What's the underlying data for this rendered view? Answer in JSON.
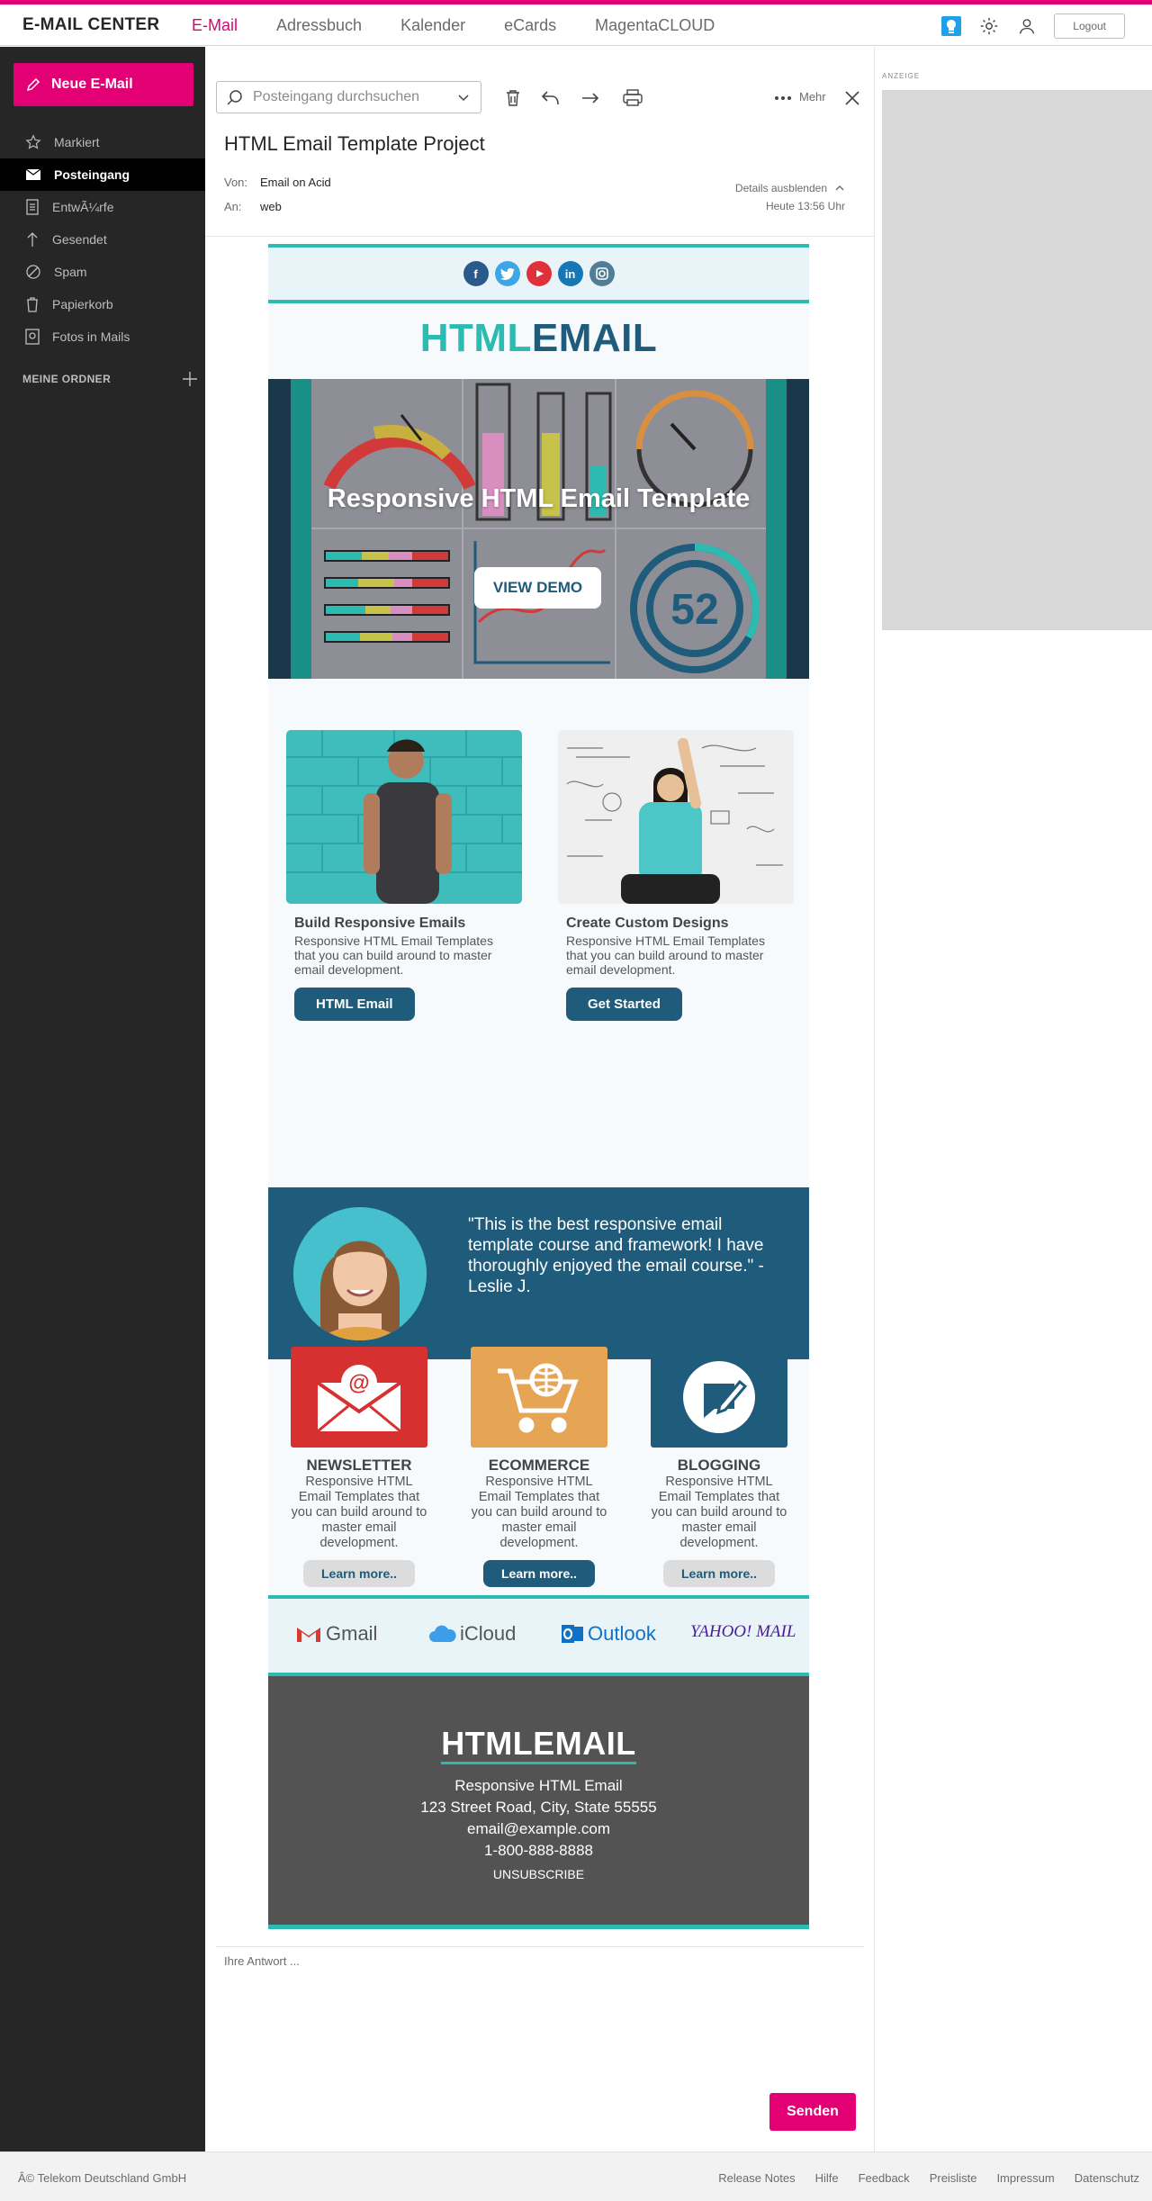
{
  "app": {
    "brand": "E-MAIL CENTER",
    "nav": [
      "E-Mail",
      "Adressbuch",
      "Kalender",
      "eCards",
      "MagentaCLOUD"
    ],
    "logout": "Logout"
  },
  "sidebar": {
    "new_mail": "Neue E-Mail",
    "items": [
      {
        "label": "Markiert",
        "icon": "star-icon"
      },
      {
        "label": "Posteingang",
        "icon": "envelope-icon",
        "active": true
      },
      {
        "label": "EntwÃ¼rfe",
        "icon": "draft-icon"
      },
      {
        "label": "Gesendet",
        "icon": "sent-icon"
      },
      {
        "label": "Spam",
        "icon": "spam-icon"
      },
      {
        "label": "Papierkorb",
        "icon": "trash-icon"
      },
      {
        "label": "Fotos in Mails",
        "icon": "photo-icon"
      }
    ],
    "my_folders": "MEINE ORDNER"
  },
  "toolbar": {
    "search_placeholder": "Posteingang durchsuchen",
    "more": "Mehr"
  },
  "message": {
    "subject": "HTML Email Template Project",
    "from_label": "Von:",
    "from": "Email on Acid",
    "to_label": "An:",
    "to": "web",
    "details_toggle": "Details ausblenden",
    "time": "Heute 13:56 Uhr"
  },
  "email": {
    "logo_a": "HTML",
    "logo_b": "EMAIL",
    "hero_title": "Responsive HTML Email Template",
    "hero_button": "VIEW DEMO",
    "hero_gauge_number": "52",
    "cards": [
      {
        "title": "Build Responsive Emails",
        "text": "Responsive HTML Email Templates that you can build around to master email development.",
        "button": "HTML Email"
      },
      {
        "title": "Create Custom Designs",
        "text": "Responsive HTML Email Templates that you can build around to master email development.",
        "button": "Get Started"
      }
    ],
    "testimonial": "\"This is the best responsive email template course and framework! I have thoroughly enjoyed the email course.\" -Leslie J.",
    "features": [
      {
        "title": "NEWSLETTER",
        "text": "Responsive HTML Email Templates that you can build around to master email development.",
        "button": "Learn more.."
      },
      {
        "title": "ECOMMERCE",
        "text": "Responsive HTML Email Templates that you can build around to master email development.",
        "button": "Learn more.."
      },
      {
        "title": "BLOGGING",
        "text": "Responsive HTML Email Templates that you can build around to master email development.",
        "button": "Learn more.."
      }
    ],
    "clients": [
      "Gmail",
      "iCloud",
      "Outlook",
      "YAHOO! MAIL"
    ],
    "footer": {
      "logo": "HTMLEMAIL",
      "name": "Responsive HTML Email",
      "address": "123 Street Road, City, State 55555",
      "email": "email@example.com",
      "phone": "1-800-888-8888",
      "unsubscribe": "UNSUBSCRIBE"
    }
  },
  "reply": {
    "placeholder": "Ihre Antwort ...",
    "send": "Senden"
  },
  "ad": {
    "label": "ANZEIGE"
  },
  "page_footer": {
    "copyright": "Â© Telekom Deutschland GmbH",
    "links": [
      "Release Notes",
      "Hilfe",
      "Feedback",
      "Preisliste",
      "Impressum",
      "Datenschutz"
    ]
  },
  "colors": {
    "magenta": "#e20074",
    "teal": "#2dbbb1",
    "navy": "#1f5b7a",
    "sidebar": "#262626"
  }
}
